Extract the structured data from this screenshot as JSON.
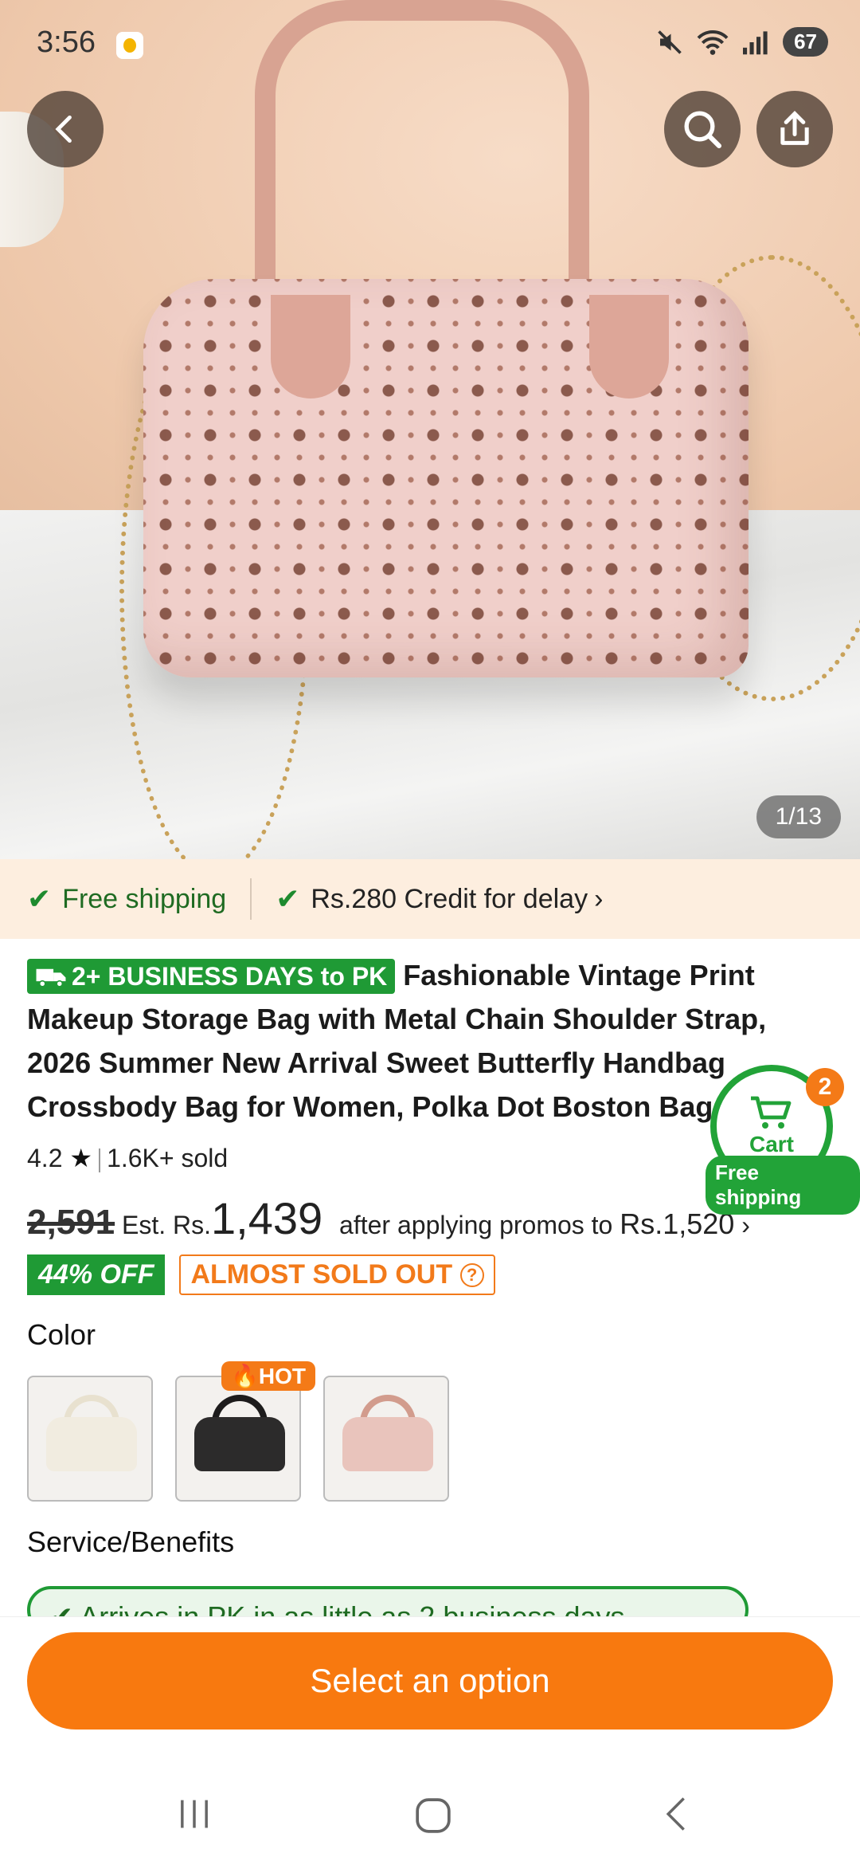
{
  "status_bar": {
    "time": "3:56",
    "battery": "67"
  },
  "image_counter": "1/13",
  "shipping": {
    "free_label": "Free shipping",
    "credit_label": "Rs.280 Credit for delay"
  },
  "product": {
    "badge": "2+ BUSINESS DAYS to PK",
    "title": "Fashionable Vintage Print Makeup Storage Bag with Metal Chain Shoulder Strap, 2026 Summer New Arrival Sweet Butterfly Handbag Crossbody Bag for Women, Polka Dot Boston Bag",
    "rating": "4.2",
    "sold": "1.6K+ sold",
    "old_price": "2,591",
    "est_prefix": "Est. Rs.",
    "est_price": "1,439",
    "promo_text": "after applying promos to",
    "promo_price": "Rs.1,520",
    "discount": "44% OFF",
    "stock_tag": "ALMOST SOLD OUT"
  },
  "color_section": {
    "label": "Color",
    "hot_badge": "HOT",
    "options": [
      {
        "name": "white",
        "color": "#f1ece0",
        "handle": "#e8e1cf"
      },
      {
        "name": "black",
        "color": "#2c2b2b",
        "handle": "#1d1c1c"
      },
      {
        "name": "pink",
        "color": "#e9c4bc",
        "handle": "#d29c8d"
      }
    ]
  },
  "service": {
    "label": "Service/Benefits",
    "pill_text": "Arrives in PK in as little as 2 business days"
  },
  "cart": {
    "label": "Cart",
    "count": "2",
    "ship_label": "Free shipping"
  },
  "cta_label": "Select an option",
  "colors": {
    "accent": "#f8790f",
    "green": "#1f9a35"
  }
}
